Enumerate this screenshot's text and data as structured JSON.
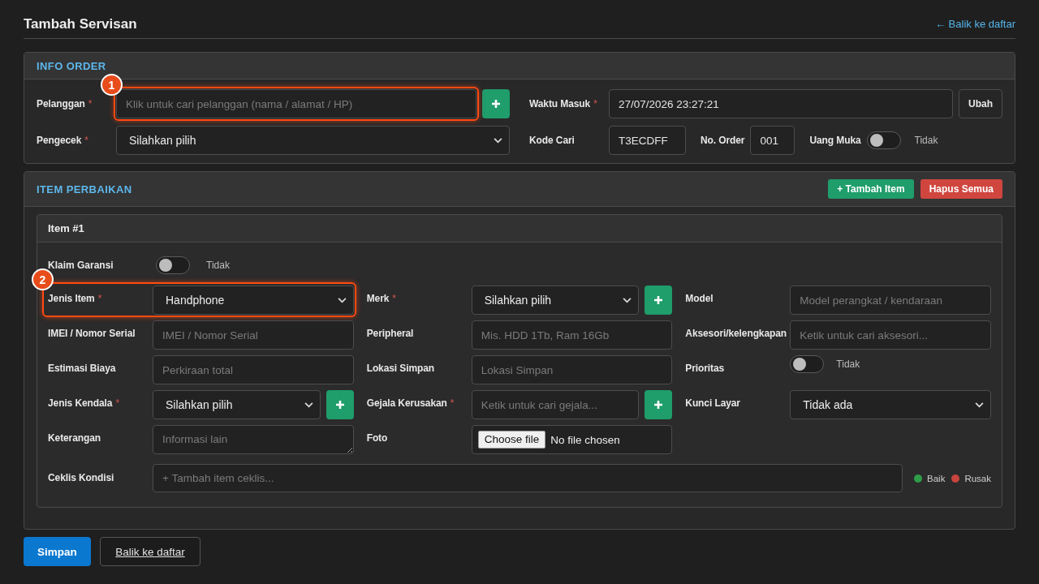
{
  "header": {
    "title": "Tambah Servisan",
    "back_link": "← Balik ke daftar"
  },
  "info_order": {
    "title": "INFO ORDER",
    "rows": [
      {
        "fields": [
          {
            "kind": "text",
            "label": "Pelanggan",
            "required_mark": "*",
            "placeholder": "Klik untuk cari pelanggan (nama / alamat / HP)",
            "add_button": true,
            "callout": {
              "number": "1",
              "wraps_label": false
            }
          },
          {
            "kind": "text",
            "label": "Waktu Masuk",
            "required_mark": "*",
            "value": "27/07/2026 23:27:21",
            "button": "Ubah"
          }
        ]
      },
      {
        "fields": [
          {
            "kind": "select",
            "label": "Pengecek",
            "required_mark": "*",
            "value": "Silahkan pilih"
          },
          {
            "kind": "text",
            "label": "Kode Cari",
            "value": "T3ECDFF"
          },
          {
            "kind": "text",
            "label": "No. Order",
            "value": "001"
          },
          {
            "kind": "toggle",
            "label": "Uang Muka",
            "on": false,
            "state_label": "Tidak"
          }
        ]
      }
    ]
  },
  "repair_items": {
    "title": "ITEM PERBAIKAN",
    "buttons": [
      {
        "label": "+ Tambah Item",
        "kind": "success"
      },
      {
        "label": "Hapus Semua",
        "kind": "danger"
      }
    ],
    "items": [
      {
        "title": "Item #1",
        "warranty_claim": {
          "label": "Klaim Garansi",
          "on": false,
          "state_label": "Tidak"
        },
        "fields": [
          {
            "kind": "select",
            "label": "Jenis Item",
            "required_mark": "*",
            "value": "Handphone",
            "callout": {
              "number": "2",
              "wraps_label": true
            }
          },
          {
            "kind": "select",
            "label": "Merk",
            "required_mark": "*",
            "value": "Silahkan pilih",
            "add_button": true
          },
          {
            "kind": "text",
            "label": "Model",
            "placeholder": "Model perangkat / kendaraan"
          },
          {
            "kind": "text",
            "label": "IMEI / Nomor Serial",
            "placeholder": "IMEI / Nomor Serial"
          },
          {
            "kind": "text",
            "label": "Peripheral",
            "placeholder": "Mis. HDD 1Tb, Ram 16Gb"
          },
          {
            "kind": "text",
            "label": "Aksesori/kelengkapan",
            "placeholder": "Ketik untuk cari aksesori..."
          },
          {
            "kind": "text",
            "label": "Estimasi Biaya",
            "placeholder": "Perkiraan total"
          },
          {
            "kind": "text",
            "label": "Lokasi Simpan",
            "placeholder": "Lokasi Simpan"
          },
          {
            "kind": "toggle",
            "label": "Prioritas",
            "on": false,
            "state_label": "Tidak"
          },
          {
            "kind": "select",
            "label": "Jenis Kendala",
            "required_mark": "*",
            "value": "Silahkan pilih",
            "add_button": true
          },
          {
            "kind": "text",
            "label": "Gejala Kerusakan",
            "required_mark": "*",
            "placeholder": "Ketik untuk cari gejala...",
            "add_button": true
          },
          {
            "kind": "select",
            "label": "Kunci Layar",
            "value": "Tidak ada"
          },
          {
            "kind": "textarea",
            "label": "Keterangan",
            "placeholder": "Informasi lain"
          },
          {
            "kind": "file",
            "label": "Foto",
            "button": "Choose file",
            "status": "No file chosen"
          }
        ],
        "checklist": {
          "label": "Ceklis Kondisi",
          "placeholder": "+ Tambah item ceklis...",
          "legend": [
            {
              "label": "Baik",
              "color": "#2e9e48"
            },
            {
              "label": "Rusak",
              "color": "#c9443e"
            }
          ]
        }
      }
    ]
  },
  "footer_buttons": [
    {
      "label": "Simpan",
      "kind": "primary"
    },
    {
      "label": "Balik ke daftar",
      "kind": "secondary"
    }
  ]
}
